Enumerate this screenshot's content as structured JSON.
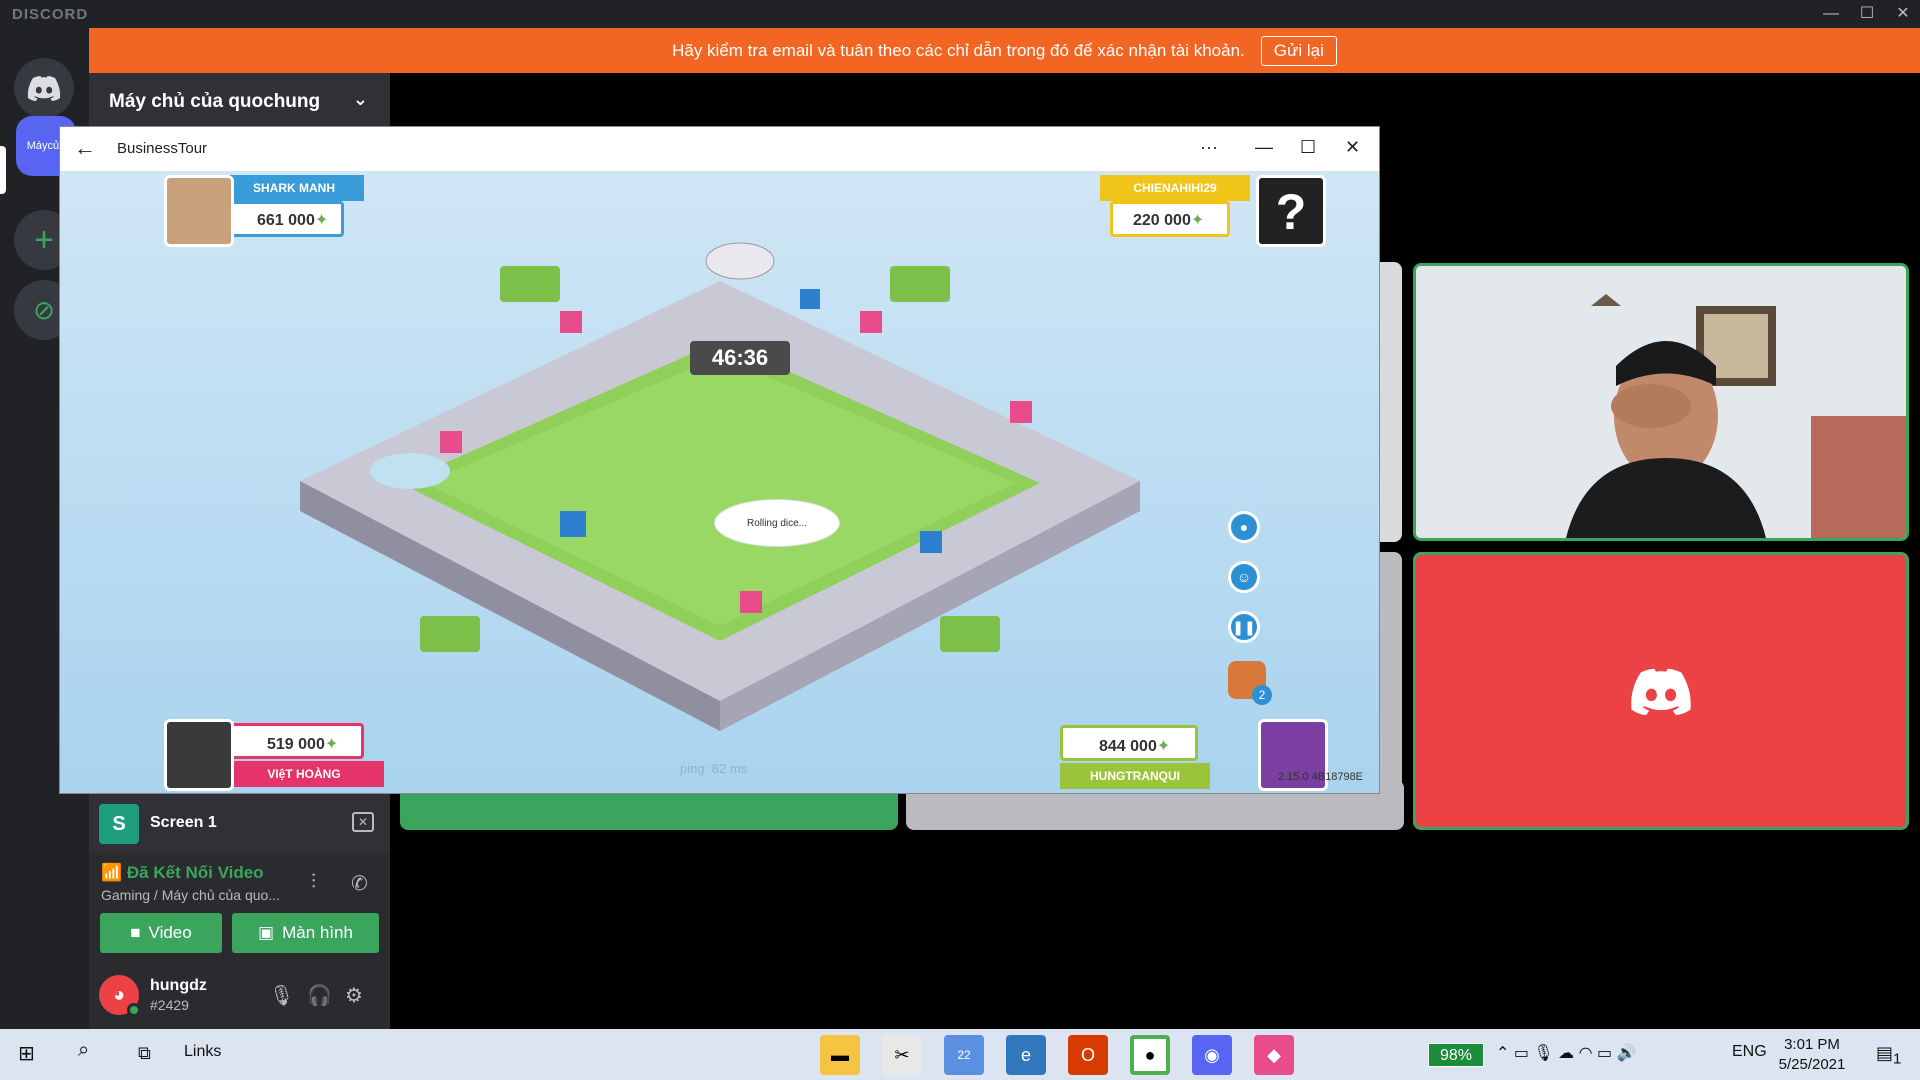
{
  "app": {
    "brand": "DISCORD"
  },
  "window_controls": [
    "—",
    "☐",
    "✕"
  ],
  "banner": {
    "text": "Hãy kiểm tra email và tuân theo các chỉ dẫn trong đó để xác nhận tài khoản.",
    "button": "Gửi lại",
    "color": "#f26522"
  },
  "guilds": {
    "server_label": "Máycủa"
  },
  "server": {
    "name": "Máy chủ của quochung"
  },
  "screen_panel": {
    "avatar_letter": "S",
    "label": "Screen 1"
  },
  "voice": {
    "status": "Đã Kết Nối Video",
    "subtitle": "Gaming / Máy chủ của quo...",
    "video_button": "Video",
    "screen_button": "Màn hình"
  },
  "user": {
    "name": "hungdz",
    "tag": "#2429"
  },
  "game_window": {
    "title": "BusinessTour",
    "more": "···",
    "timer": "46:36",
    "rolling": "Rolling dice...",
    "ping": "ping: 82 ms",
    "version": "2.15.0 4B18798E",
    "players": [
      {
        "name": "SHARK MANH",
        "money": "661 000",
        "color": "#3a9bd9"
      },
      {
        "name": "CHIENAHIHI29",
        "money": "220 000",
        "color": "#f0c419"
      },
      {
        "name": "VIệT HOÀNG",
        "money": "519 000",
        "color": "#e6346a"
      },
      {
        "name": "HUNGTRANQUI",
        "money": "844 000",
        "color": "#9bc43a"
      }
    ],
    "mystery": "?",
    "bag_count": "2"
  },
  "taskbar": {
    "links": "Links",
    "badge": "22",
    "battery": "98%",
    "lang": "ENG",
    "time": "3:01 PM",
    "date": "5/25/2021",
    "notif_count": "1"
  },
  "colors": {
    "green": "#3ba55d",
    "red": "#ed4245",
    "blurple": "#5865f2"
  }
}
